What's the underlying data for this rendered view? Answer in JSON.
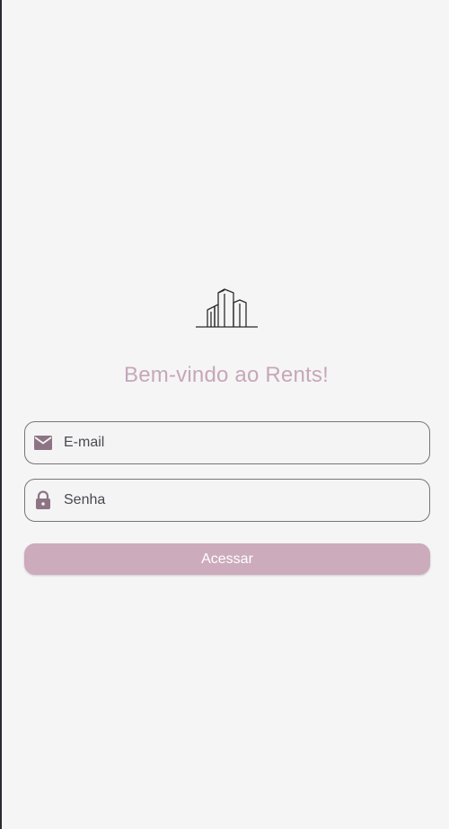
{
  "login": {
    "logo_icon": "buildings-icon",
    "title": "Bem-vindo ao Rents!",
    "email": {
      "placeholder": "E-mail",
      "value": "",
      "icon": "mail-icon"
    },
    "password": {
      "placeholder": "Senha",
      "value": "",
      "icon": "lock-icon"
    },
    "submit_label": "Acessar"
  },
  "colors": {
    "background": "#f5f5f5",
    "title": "#c6a7b8",
    "button": "#ccabbc",
    "button_text": "#ffffff",
    "icon": "#8c7485",
    "field_border": "#7a7477"
  }
}
